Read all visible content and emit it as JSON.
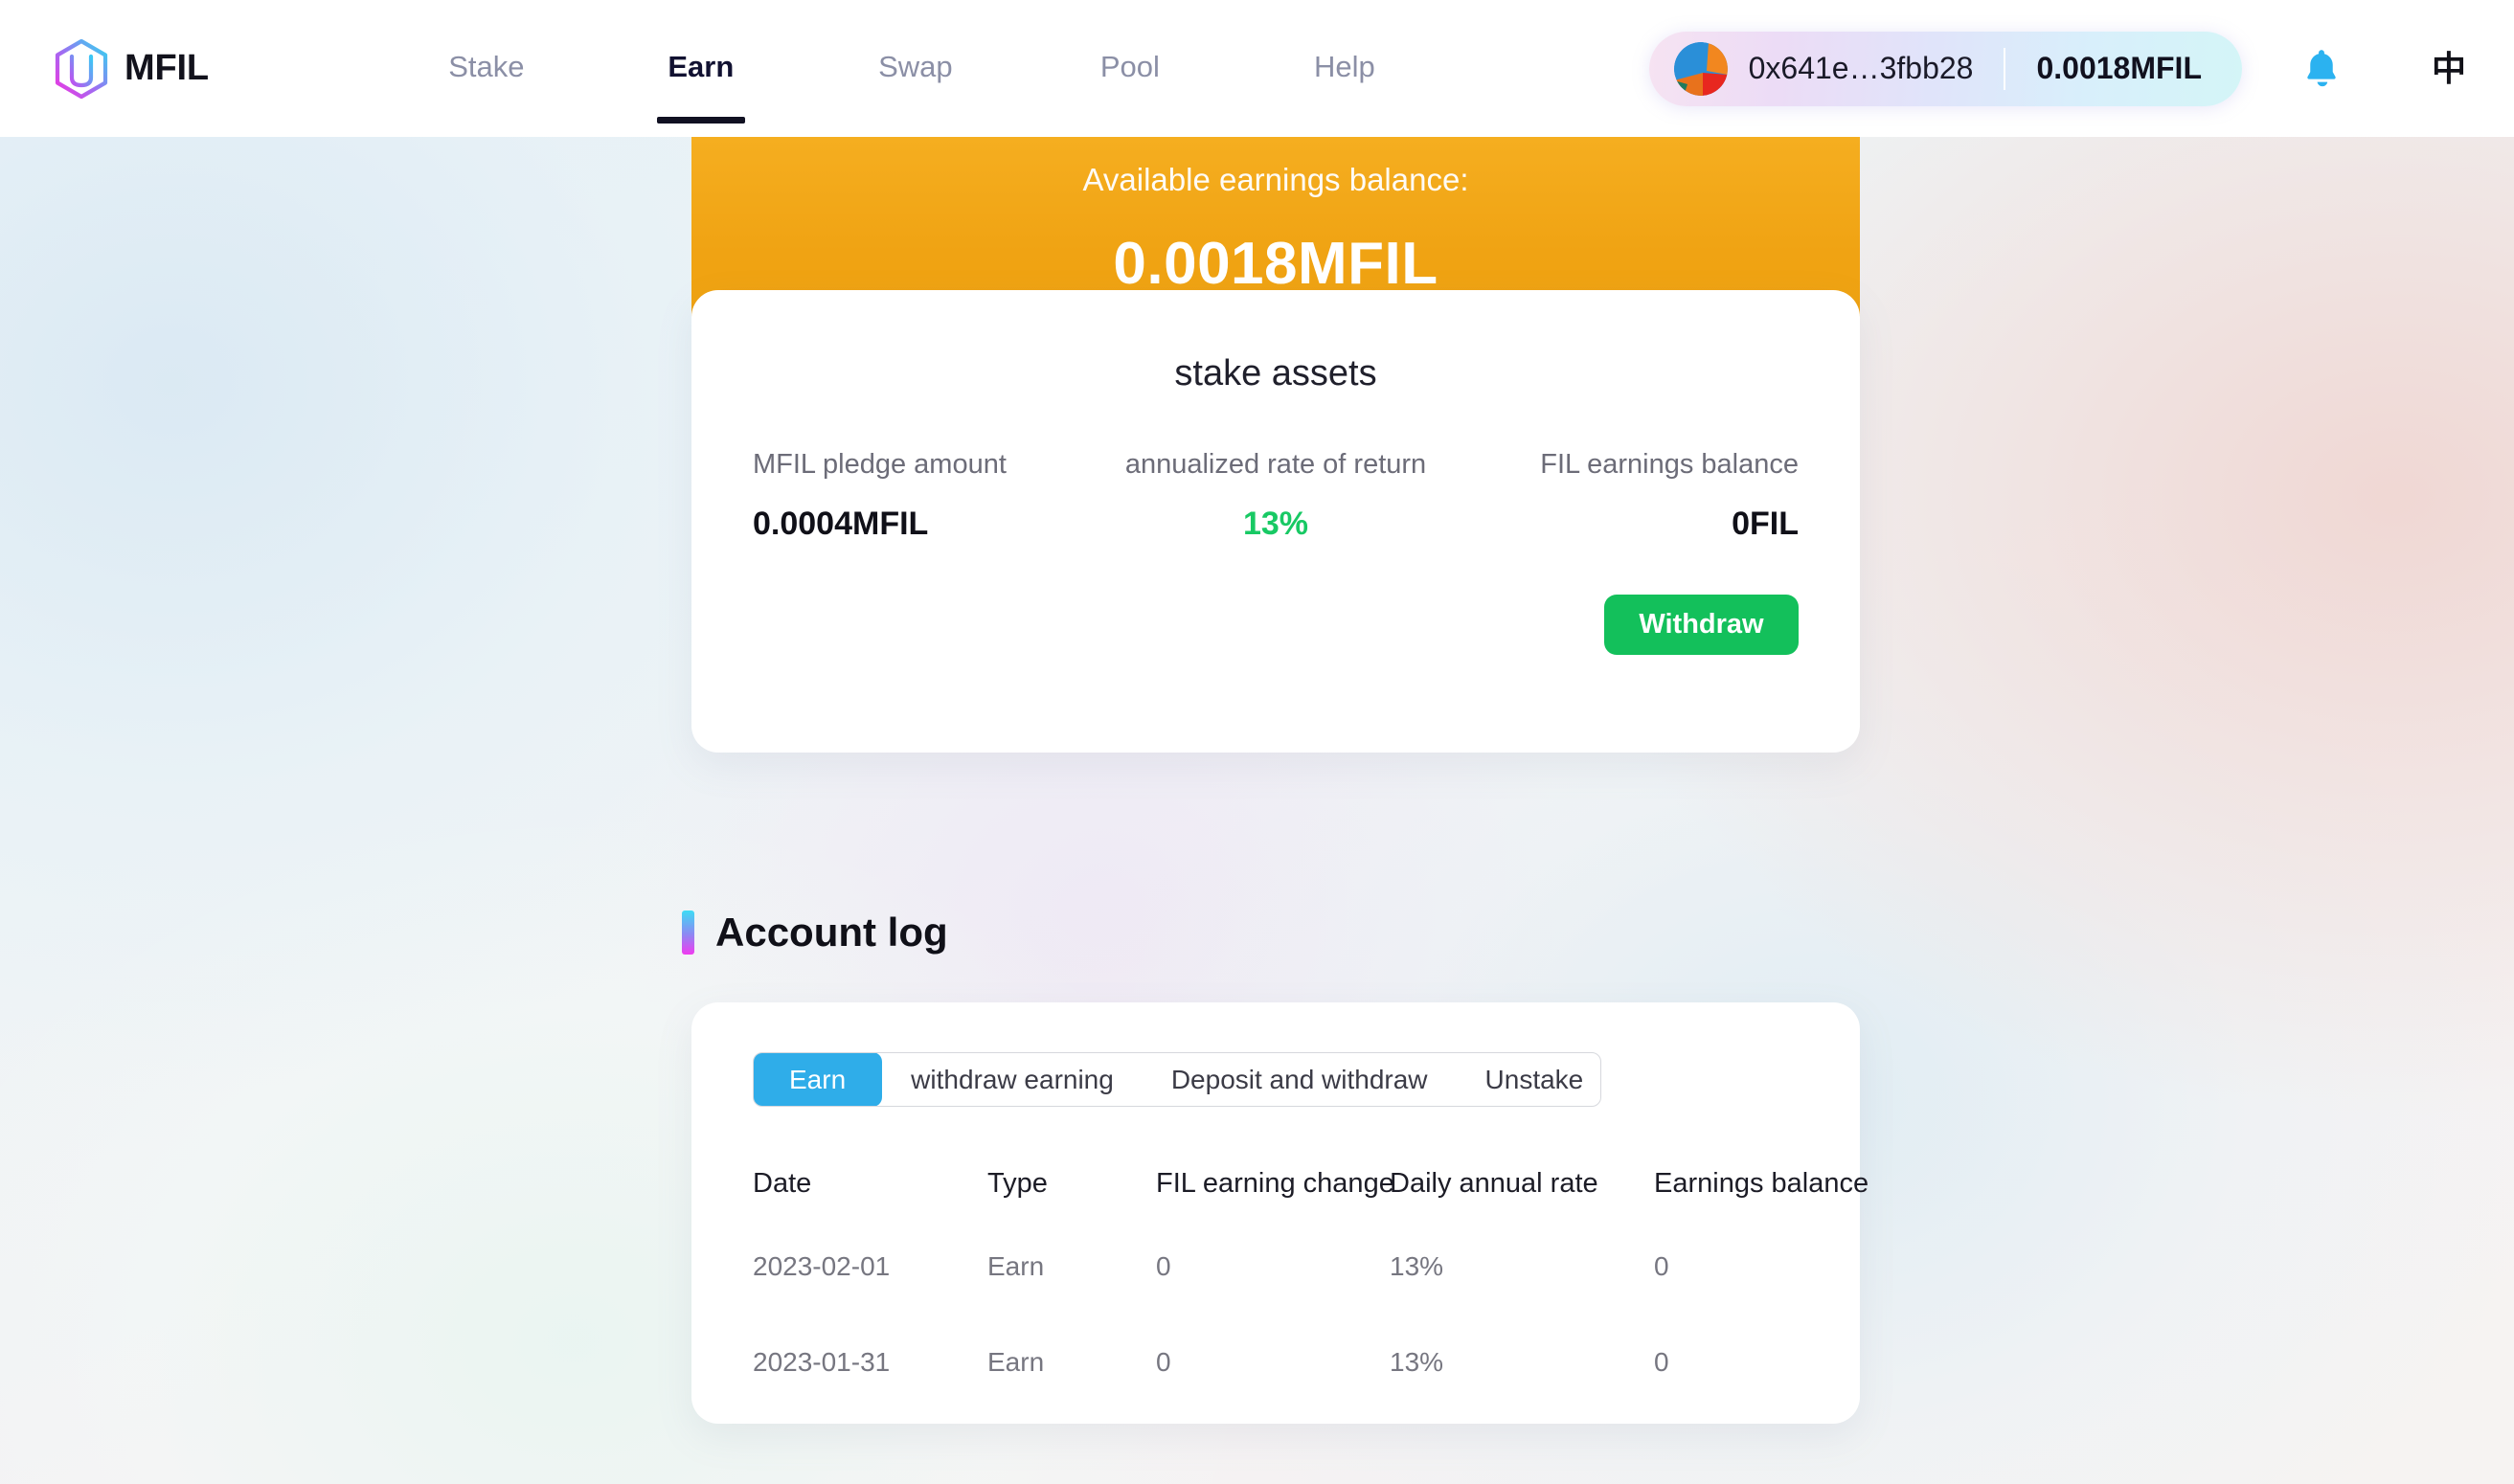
{
  "brand": {
    "name": "MFIL",
    "logo_icon": "mfil-hexagon-logo"
  },
  "nav": {
    "items": [
      {
        "label": "Stake",
        "active": false
      },
      {
        "label": "Earn",
        "active": true
      },
      {
        "label": "Swap",
        "active": false
      },
      {
        "label": "Pool",
        "active": false
      },
      {
        "label": "Help",
        "active": false
      }
    ]
  },
  "wallet": {
    "avatar_icon": "wallet-blockie-avatar",
    "address": "0x641e…3fbb28",
    "balance": "0.0018MFIL"
  },
  "topbar_actions": {
    "notifications_icon": "bell-icon",
    "language_label": "中"
  },
  "earnings": {
    "label": "Available earnings balance:",
    "value": "0.0018MFIL"
  },
  "stake": {
    "title": "stake assets",
    "metrics": [
      {
        "label": "MFIL pledge amount",
        "value": "0.0004MFIL"
      },
      {
        "label": "annualized rate of return",
        "value": "13%"
      },
      {
        "label": "FIL earnings balance",
        "value": "0FIL"
      }
    ],
    "withdraw_label": "Withdraw"
  },
  "account_log": {
    "title": "Account log",
    "tabs": [
      {
        "label": "Earn",
        "active": true
      },
      {
        "label": "withdraw earning",
        "active": false
      },
      {
        "label": "Deposit and withdraw",
        "active": false
      },
      {
        "label": "Unstake",
        "active": false
      }
    ],
    "table": {
      "headers": [
        "Date",
        "Type",
        "FIL earning change",
        "Daily annual rate",
        "Earnings balance"
      ],
      "rows": [
        [
          "2023-02-01",
          "Earn",
          "0",
          "13%",
          "0"
        ],
        [
          "2023-01-31",
          "Earn",
          "0",
          "13%",
          "0"
        ]
      ]
    }
  },
  "colors": {
    "banner_orange": "#F0A313",
    "accent_green": "#13C05B",
    "rate_green": "#18C964",
    "tab_blue": "#2FADE9",
    "bell_blue": "#2BB2F0",
    "nav_active": "#111131"
  }
}
